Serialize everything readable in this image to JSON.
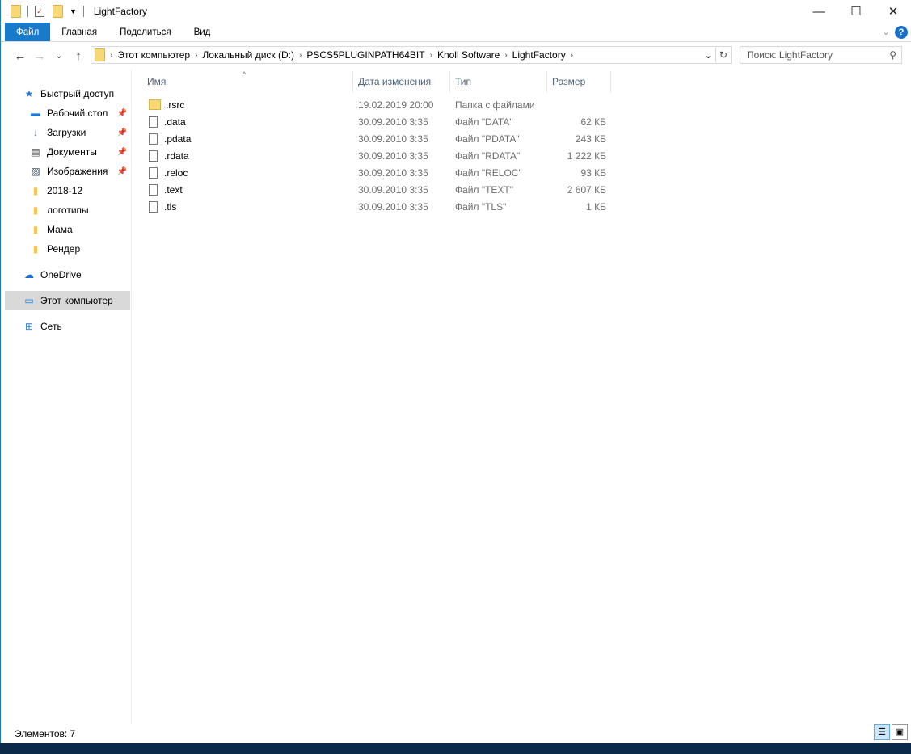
{
  "window": {
    "title": "LightFactory"
  },
  "ribbon": {
    "tabs": [
      "Файл",
      "Главная",
      "Поделиться",
      "Вид"
    ]
  },
  "address": {
    "crumbs": [
      "Этот компьютер",
      "Локальный диск (D:)",
      "PSCS5PLUGINPATH64BIT",
      "Knoll Software",
      "LightFactory"
    ]
  },
  "search": {
    "placeholder": "Поиск: LightFactory"
  },
  "sidebar": {
    "items": [
      {
        "label": "Быстрый доступ",
        "icon": "star-icon"
      },
      {
        "label": "Рабочий стол",
        "icon": "desktop-icon",
        "pinned": true
      },
      {
        "label": "Загрузки",
        "icon": "download-icon",
        "pinned": true
      },
      {
        "label": "Документы",
        "icon": "documents-icon",
        "pinned": true
      },
      {
        "label": "Изображения",
        "icon": "pictures-icon",
        "pinned": true
      },
      {
        "label": "2018-12",
        "icon": "folder-icon"
      },
      {
        "label": "логотипы",
        "icon": "folder-icon"
      },
      {
        "label": "Мама",
        "icon": "folder-icon"
      },
      {
        "label": "Рендер",
        "icon": "folder-icon"
      },
      {
        "label": "OneDrive",
        "icon": "cloud-icon"
      },
      {
        "label": "Этот компьютер",
        "icon": "computer-icon"
      },
      {
        "label": "Сеть",
        "icon": "network-icon"
      }
    ]
  },
  "columns": [
    "Имя",
    "Дата изменения",
    "Тип",
    "Размер"
  ],
  "files": [
    {
      "name": ".rsrc",
      "date": "19.02.2019 20:00",
      "type": "Папка с файлами",
      "size": ""
    },
    {
      "name": ".data",
      "date": "30.09.2010 3:35",
      "type": "Файл \"DATA\"",
      "size": "62 КБ"
    },
    {
      "name": ".pdata",
      "date": "30.09.2010 3:35",
      "type": "Файл \"PDATA\"",
      "size": "243 КБ"
    },
    {
      "name": ".rdata",
      "date": "30.09.2010 3:35",
      "type": "Файл \"RDATA\"",
      "size": "1 222 КБ"
    },
    {
      "name": ".reloc",
      "date": "30.09.2010 3:35",
      "type": "Файл \"RELOC\"",
      "size": "93 КБ"
    },
    {
      "name": ".text",
      "date": "30.09.2010 3:35",
      "type": "Файл \"TEXT\"",
      "size": "2 607 КБ"
    },
    {
      "name": ".tls",
      "date": "30.09.2010 3:35",
      "type": "Файл \"TLS\"",
      "size": "1 КБ"
    }
  ],
  "status": {
    "count": "Элементов: 7"
  }
}
